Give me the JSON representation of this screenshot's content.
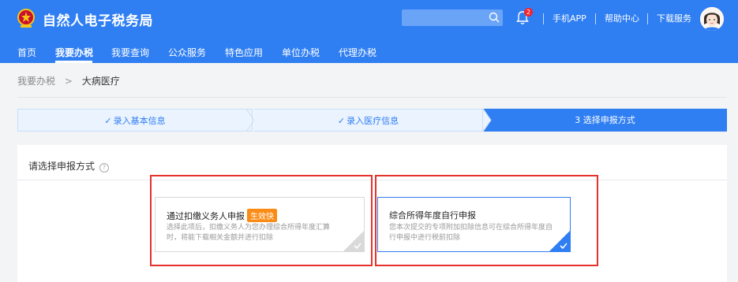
{
  "header": {
    "app_title": "自然人电子税务局",
    "search": {
      "placeholder": ""
    },
    "notification_count": "2",
    "links": [
      "手机APP",
      "帮助中心",
      "下载服务"
    ]
  },
  "nav": {
    "items": [
      "首页",
      "我要办税",
      "我要查询",
      "公众服务",
      "特色应用",
      "单位办税",
      "代理办税"
    ],
    "active": "我要办税"
  },
  "breadcrumb": {
    "parent": "我要办税",
    "separator": ">",
    "current": "大病医疗"
  },
  "steps": [
    {
      "label": "录入基本信息",
      "status": "done"
    },
    {
      "label": "录入医疗信息",
      "status": "done"
    },
    {
      "label": "3 选择申报方式",
      "status": "active"
    }
  ],
  "panel": {
    "title": "请选择申报方式",
    "options": [
      {
        "title": "通过扣缴义务人申报",
        "tag": "生效快",
        "desc": "选择此项后，扣缴义务人为您办理综合所得年度汇算时，将能下载相关金额并进行扣除",
        "selected": false
      },
      {
        "title": "综合所得年度自行申报",
        "tag": "",
        "desc": "您本次提交的专项附加扣除信息可在综合所得年度自行申报中进行税前扣除",
        "selected": true
      }
    ]
  },
  "colors": {
    "primary": "#2f7ef2",
    "highlight_frame": "#e5322d",
    "tag": "#fa8c16",
    "step_done_bg": "#eaf3fe"
  },
  "icons": [
    "tax-emblem-icon",
    "search-icon",
    "bell-icon",
    "avatar",
    "chevron-right-icon",
    "check-icon",
    "help-icon",
    "corner-check-icon"
  ]
}
